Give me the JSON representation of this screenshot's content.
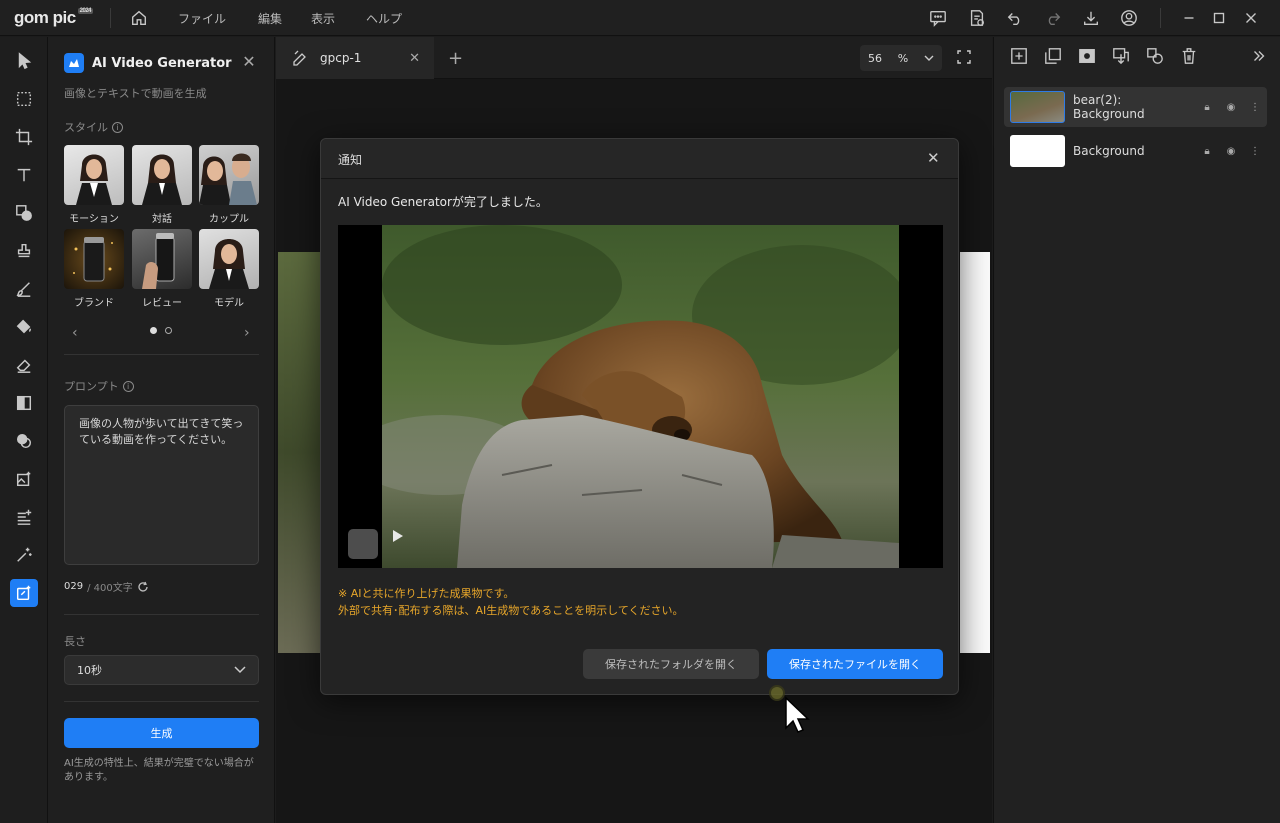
{
  "app": {
    "logo": "gom pic",
    "logo_badge": "2024"
  },
  "menu": [
    "ファイル",
    "編集",
    "表示",
    "ヘルプ"
  ],
  "left_panel": {
    "title": "AI Video Generator",
    "subtitle": "画像とテキストで動画を生成",
    "style_label": "スタイル",
    "styles": [
      "モーション",
      "対話",
      "カップル",
      "ブランド",
      "レビュー",
      "モデル"
    ],
    "prompt_label": "プロンプト",
    "prompt_text": "画像の人物が歩いて出てきて笑っている動画を作ってください。",
    "char_count": "029",
    "char_max": "/ 400文字",
    "length_label": "長さ",
    "length_value": "10秒",
    "generate_label": "生成",
    "note": "AI生成の特性上、結果が完璧でない場合があります。"
  },
  "document": {
    "tab_name": "gpcp-1",
    "zoom_value": "56",
    "zoom_unit": "%"
  },
  "layers": [
    {
      "name": "bear(2): Background"
    },
    {
      "name": "Background"
    }
  ],
  "dialog": {
    "title": "通知",
    "message": "AI Video Generatorが完了しました。",
    "warning_line1": "※ AIと共に作り上げた成果物です。",
    "warning_line2": "外部で共有･配布する際は、AI生成物であることを明示してください。",
    "open_folder_label": "保存されたフォルダを開く",
    "open_file_label": "保存されたファイルを開く"
  },
  "colors": {
    "accent": "#1f7ef5",
    "warning": "#e7a62a"
  }
}
